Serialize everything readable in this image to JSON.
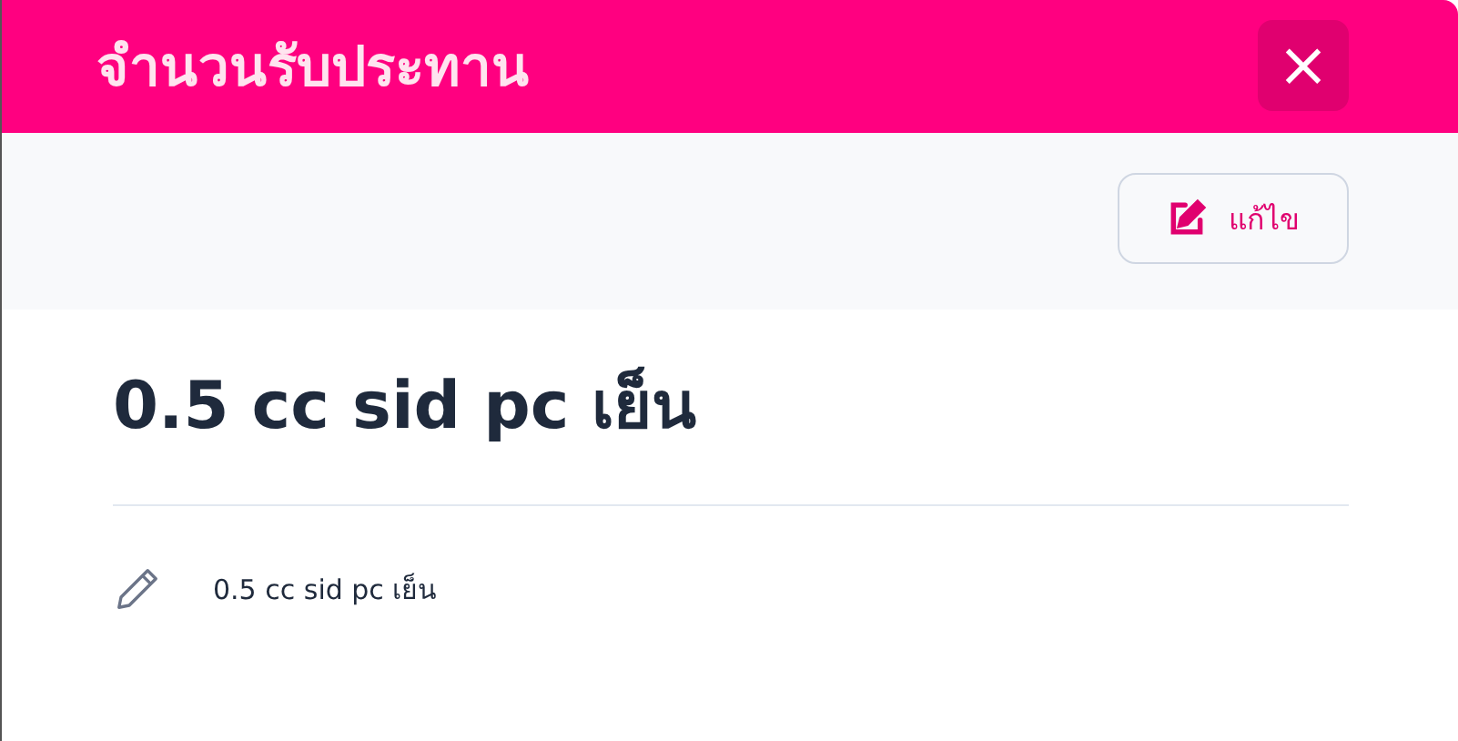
{
  "header": {
    "title": "จำนวนรับประทาน",
    "close": "×"
  },
  "toolbar": {
    "edit_button": "แก้ไข"
  },
  "item": {
    "heading": "0.5 cc sid pc เย็น",
    "detail": "0.5 cc sid pc เย็น"
  }
}
